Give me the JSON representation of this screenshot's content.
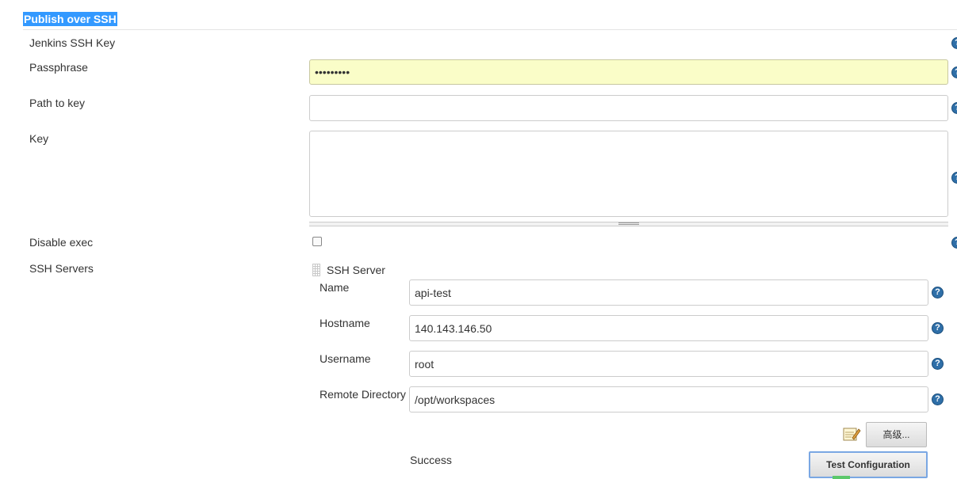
{
  "section": {
    "title": "Publish over SSH"
  },
  "labels": {
    "jenkins_ssh_key": "Jenkins SSH Key",
    "passphrase": "Passphrase",
    "path_to_key": "Path to key",
    "key": "Key",
    "disable_exec": "Disable exec",
    "ssh_servers": "SSH Servers"
  },
  "fields": {
    "passphrase": "•••••••••",
    "path_to_key": "",
    "key": ""
  },
  "ssh_server": {
    "heading": "SSH Server",
    "name_label": "Name",
    "name_value": "api-test",
    "hostname_label": "Hostname",
    "hostname_value": "140.143.146.50",
    "username_label": "Username",
    "username_value": "root",
    "remote_dir_label": "Remote Directory",
    "remote_dir_value": "/opt/workspaces",
    "advanced_button": "高级...",
    "status": "Success",
    "test_button": "Test Configuration"
  },
  "help_glyph": "?",
  "colors": {
    "title_highlight": "#3399ff",
    "autofill": "#fafdc8",
    "help": "#2f6fa8"
  }
}
